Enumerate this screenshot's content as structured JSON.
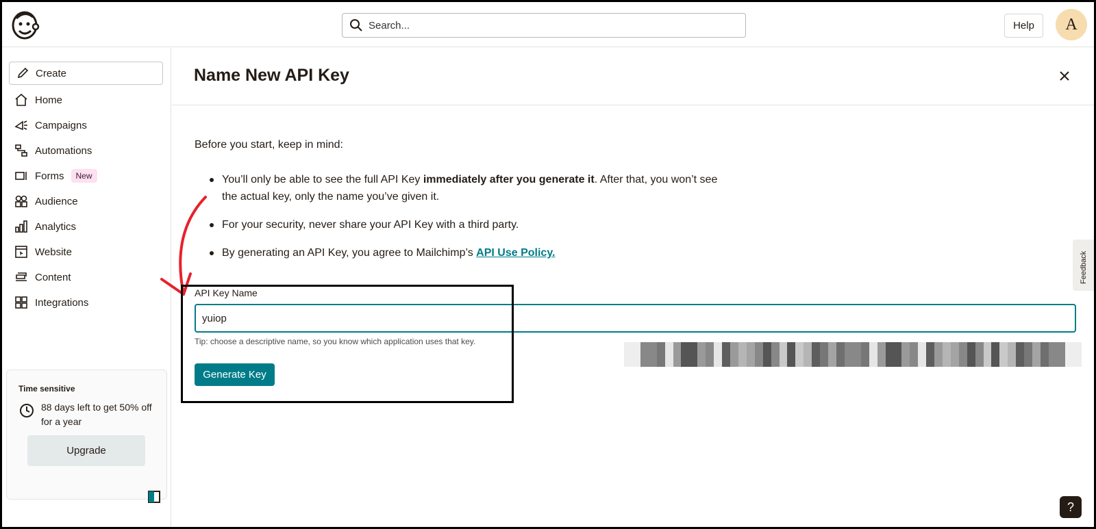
{
  "topbar": {
    "search_placeholder": "Search...",
    "help_label": "Help",
    "avatar_initial": "A"
  },
  "sidebar": {
    "create_label": "Create",
    "items": [
      {
        "label": "Home",
        "icon": "home-icon"
      },
      {
        "label": "Campaigns",
        "icon": "megaphone-icon"
      },
      {
        "label": "Automations",
        "icon": "automation-icon"
      },
      {
        "label": "Forms",
        "icon": "form-icon",
        "badge": "New"
      },
      {
        "label": "Audience",
        "icon": "audience-icon"
      },
      {
        "label": "Analytics",
        "icon": "bar-chart-icon"
      },
      {
        "label": "Website",
        "icon": "website-icon"
      },
      {
        "label": "Content",
        "icon": "content-icon"
      },
      {
        "label": "Integrations",
        "icon": "grid-icon"
      }
    ],
    "promo": {
      "title": "Time sensitive",
      "text": "88 days left to get 50% off for a year",
      "button": "Upgrade"
    }
  },
  "main": {
    "title": "Name New API Key",
    "intro": "Before you start, keep in mind:",
    "bullet1_pre": "You’ll only be able to see the full API Key ",
    "bullet1_bold": "immediately after you generate it",
    "bullet1_post": ". After that, you won’t see the actual key, only the name you’ve given it.",
    "bullet2": "For your security, never share your API Key with a third party.",
    "bullet3_pre": "By generating an API Key, you agree to Mailchimp’s ",
    "bullet3_link": "API Use Policy.",
    "field_label": "API Key Name",
    "field_value": "yuiop",
    "tip": "Tip: choose a descriptive name, so you know which application uses that key.",
    "generate_button": "Generate Key"
  },
  "feedback_label": "Feedback",
  "help_fab_label": "?",
  "colors": {
    "accent": "#007c89",
    "text": "#241c15",
    "avatar_bg": "#f6dcae",
    "annotation_arrow": "#e8212a"
  }
}
